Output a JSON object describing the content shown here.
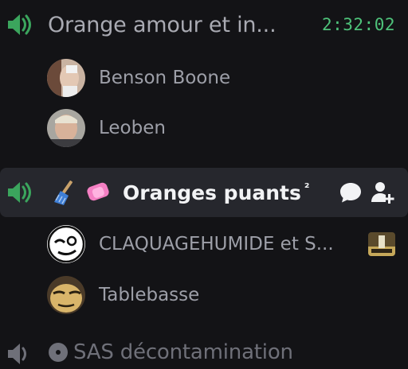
{
  "channels": [
    {
      "name": "Orange amour et in...",
      "timer": "2:32:02",
      "icon": "voice-speaker-icon",
      "users": [
        {
          "name": "Benson Boone",
          "avatar": "avatar-benson"
        },
        {
          "name": "Leoben",
          "avatar": "avatar-leoben"
        }
      ]
    },
    {
      "name": "Oranges puants",
      "superscript": "²",
      "active": true,
      "icon": "voice-speaker-icon",
      "emoji": [
        "broom-icon",
        "pink-eraser-icon"
      ],
      "actions": [
        "chat-bubble-icon",
        "add-user-icon"
      ],
      "users": [
        {
          "name": "CLAQUAGEHUMIDE et S...",
          "avatar": "avatar-claquage",
          "activity": "game-activity-icon"
        },
        {
          "name": "Tablebasse",
          "avatar": "avatar-tablebasse"
        }
      ]
    },
    {
      "name": "SAS décontamination",
      "icon": "voice-speaker-icon",
      "emoji": [
        "radioactive-icon"
      ]
    }
  ],
  "colors": {
    "background": "#131316",
    "active_row": "#26272d",
    "timer_green": "#4ec27a",
    "voice_green": "#3ba55d"
  }
}
